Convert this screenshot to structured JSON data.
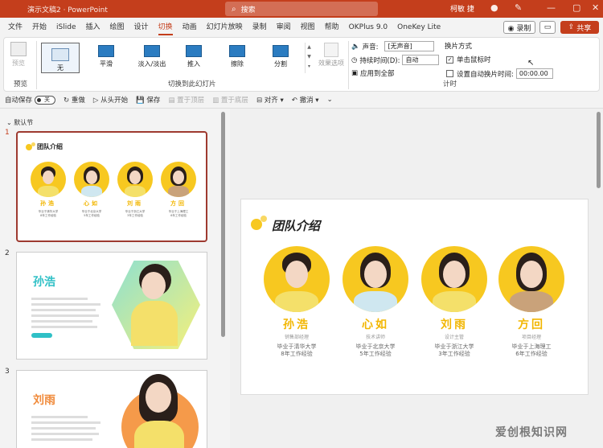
{
  "titlebar": {
    "doc_title": "演示文稿2 · PowerPoint",
    "search_placeholder": "搜索",
    "user": "柯敏 捷"
  },
  "menu": {
    "tabs": [
      "文件",
      "开始",
      "iSlide",
      "插入",
      "绘图",
      "设计",
      "切换",
      "动画",
      "幻灯片放映",
      "录制",
      "审阅",
      "视图",
      "帮助",
      "OKPlus 9.0",
      "OneKey Lite"
    ],
    "active_tab": "切换",
    "record_label": "◉ 录制",
    "share_label": "共享"
  },
  "ribbon": {
    "preview_label": "预览",
    "preview_group": "预览",
    "transitions": [
      "无",
      "平滑",
      "淡入/淡出",
      "推入",
      "擦除",
      "分割"
    ],
    "effect_options": "效果选项",
    "transitions_group": "切换到此幻灯片",
    "sound_label": "声音:",
    "sound_value": "[无声音]",
    "duration_label": "持续时间(D):",
    "duration_value": "自动",
    "apply_all": "应用到全部",
    "advance_title": "换片方式",
    "on_click_label": "单击鼠标时",
    "after_label": "设置自动换片时间:",
    "after_value": "00:00.00",
    "timing_group": "计时"
  },
  "qat": {
    "autosave": "自动保存",
    "toggle_off": "关",
    "redo": "重做",
    "from_start": "从头开始",
    "save": "保存",
    "align_top": "置于顶层",
    "align_bottom": "置于底层",
    "align": "对齐",
    "undo": "撤消"
  },
  "thumbs": {
    "section": "默认节",
    "numbers": [
      "1",
      "2",
      "3"
    ]
  },
  "slide1": {
    "title": "团队介绍",
    "members": [
      {
        "name": "孙浩",
        "role": "销售部经理",
        "school": "毕业于清华大学",
        "exp": "8年工作经验"
      },
      {
        "name": "心如",
        "role": "技术讲师",
        "school": "毕业于北京大学",
        "exp": "5年工作经验"
      },
      {
        "name": "刘雨",
        "role": "设计主管",
        "school": "毕业于浙江大学",
        "exp": "3年工作经验"
      },
      {
        "name": "方回",
        "role": "项目经理",
        "school": "毕业于上海理工",
        "exp": "6年工作经验"
      }
    ]
  },
  "slide2": {
    "name": "孙浩"
  },
  "slide3": {
    "name": "刘雨"
  },
  "watermark": "爱创根知识网",
  "colors": {
    "brand": "#c43e1c",
    "accent": "#f7c820",
    "name_gold": "#f2b600"
  }
}
